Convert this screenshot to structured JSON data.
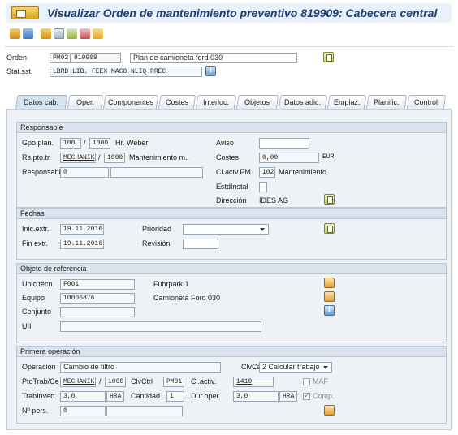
{
  "window": {
    "title": "Visualizar Orden de mantenimiento preventivo 819909: Cabecera central"
  },
  "header": {
    "orden_label": "Orden",
    "orden_type": "PM02",
    "orden_number": "819909",
    "orden_desc": "Plan de camioneta ford 030",
    "stat_label": "Stat.sst.",
    "stat_value": "LBRD LIB. FEEX MACO NLIQ PREC"
  },
  "tabs": [
    "Datos cab.",
    "Oper.",
    "Componentes",
    "Costes",
    "Interloc.",
    "Objetos",
    "Datos adic.",
    "Emplaz.",
    "Planific.",
    "Control"
  ],
  "responsable": {
    "title": "Responsable",
    "gpo_label": "Gpo.plan.",
    "gpo_code": "100",
    "gpo_slash": "/",
    "gpo_center": "1000",
    "gpo_text": "Hr. Weber",
    "rs_label": "Rs.pto.tr.",
    "rs_code": "MECHANIK",
    "rs_slash": "/",
    "rs_center": "1000",
    "rs_text": "Mantenimiento m..",
    "resp_label": "Responsable",
    "resp_value": "0",
    "aviso_label": "Aviso",
    "aviso_value": "",
    "costes_label": "Costes",
    "costes_value": "0,00",
    "costes_currency": "EUR",
    "clactv_label": "Cl.actv.PM",
    "clactv_code": "102",
    "clactv_text": "Mantenimiento",
    "estd_label": "EstdInstal",
    "dir_label": "Dirección",
    "dir_value": "IDES AG"
  },
  "fechas": {
    "title": "Fechas",
    "inic_label": "Inic.extr.",
    "inic_value": "19.11.2016",
    "fin_label": "Fin extr.",
    "fin_value": "19.11.2016",
    "prioridad_label": "Prioridad",
    "prioridad_value": "",
    "revision_label": "Revisión",
    "revision_value": ""
  },
  "objeto": {
    "title": "Objeto de referencia",
    "ubic_label": "Ubic.técn.",
    "ubic_value": "F001",
    "ubic_text": "Fuhrpark 1",
    "equipo_label": "Equipo",
    "equipo_value": "10006876",
    "equipo_text": "Camioneta Ford 030",
    "conjunto_label": "Conjunto",
    "conjunto_value": "",
    "uii_label": "UII",
    "uii_value": ""
  },
  "operacion": {
    "title": "Primera operación",
    "op_label": "Operación",
    "op_value": "Cambio de filtro",
    "clvca_label": "ClvCá",
    "clvca_value": "2 Calcular trabajo",
    "pto_label": "PtoTrab/Ce",
    "pto_code": "MECHANIK",
    "pto_slash": "/",
    "pto_center": "1000",
    "clvctrl_label": "ClvCtrl",
    "clvctrl_value": "PM01",
    "clactiv_label": "Cl.activ.",
    "clactiv_value": "1410",
    "maf_label": "MAF",
    "trab_label": "TrabInvert",
    "trab_value": "3,0",
    "trab_unit": "HRA",
    "cant_label": "Cantidad",
    "cant_value": "1",
    "dur_label": "Dur.oper.",
    "dur_value": "3,0",
    "dur_unit": "HRA",
    "comp_label": "Comp.",
    "npers_label": "Nº pers.",
    "npers_value": "0"
  },
  "icons": {
    "title": "order-icon",
    "toolbar": [
      "display-change-icon",
      "filter-icon",
      "save-icon",
      "copy-icon",
      "document-icon",
      "print-icon",
      "settings-icon"
    ]
  }
}
